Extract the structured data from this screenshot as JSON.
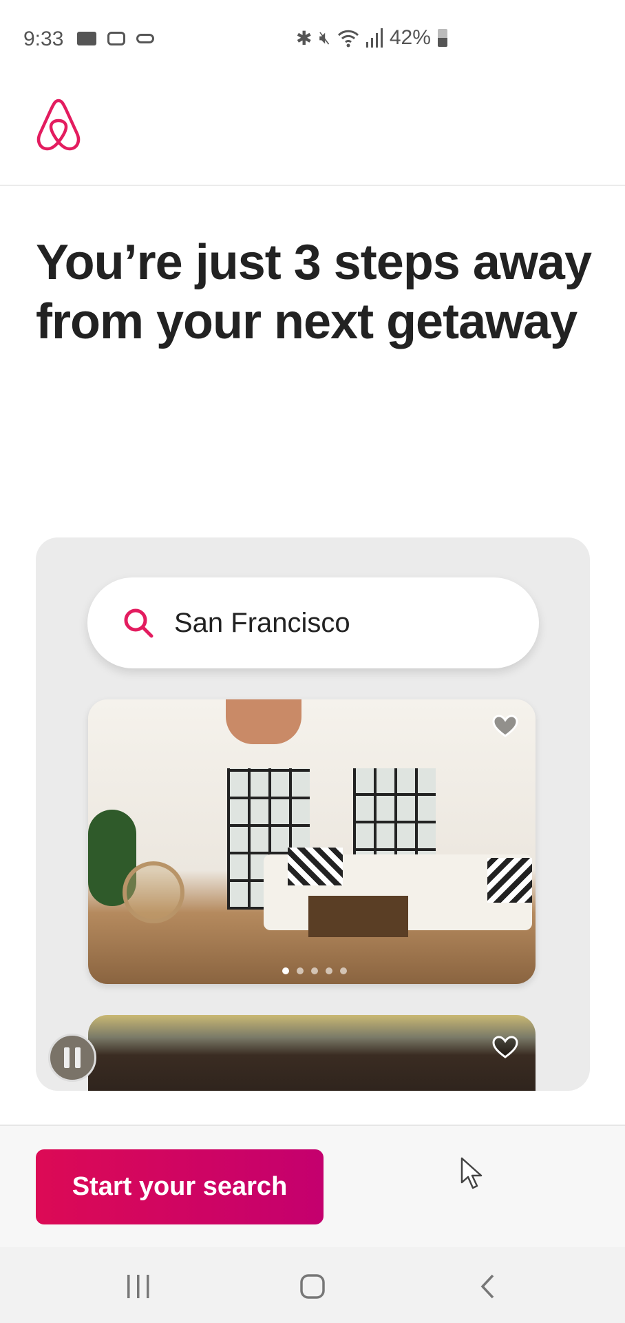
{
  "status_bar": {
    "time": "9:33",
    "battery": "42%",
    "icons": [
      "video-icon",
      "sync-icon",
      "key-icon",
      "bluetooth-icon",
      "mute-icon",
      "wifi-icon",
      "signal-icon",
      "battery-icon"
    ]
  },
  "header": {
    "logo": "airbnb-logo"
  },
  "main": {
    "headline": "You’re just 3 steps away from your next getaway",
    "search": {
      "value": "San Francisco",
      "icon": "search-icon"
    },
    "carousel": {
      "slide_count": 5,
      "active_slide": 1
    }
  },
  "footer": {
    "cta_label": "Start your search"
  },
  "colors": {
    "brand": "#E31C5F",
    "button_start": "#DC0A55",
    "button_end": "#C4006E"
  },
  "nav_bar": {
    "icons": [
      "recent-apps-icon",
      "home-icon",
      "back-icon"
    ]
  }
}
